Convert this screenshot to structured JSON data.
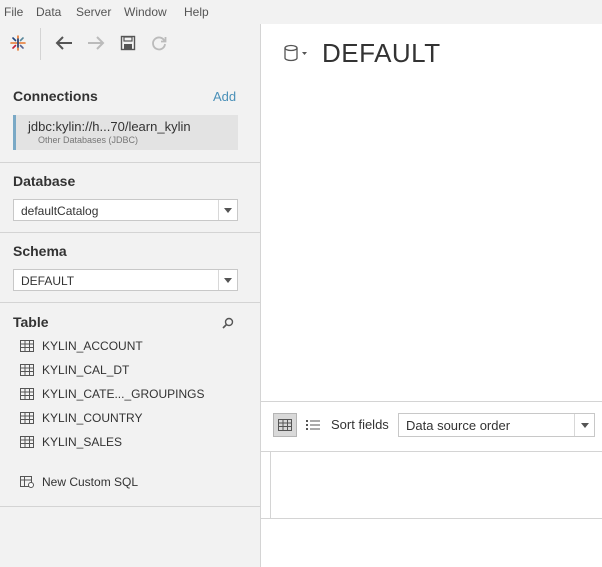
{
  "menu": [
    "File",
    "Data",
    "Server",
    "Window",
    "Help"
  ],
  "connections": {
    "title": "Connections",
    "add_label": "Add",
    "item": {
      "name": "jdbc:kylin://h...70/learn_kylin",
      "type": "Other Databases (JDBC)"
    }
  },
  "database": {
    "title": "Database",
    "value": "defaultCatalog"
  },
  "schema": {
    "title": "Schema",
    "value": "DEFAULT"
  },
  "table": {
    "title": "Table",
    "items": [
      "KYLIN_ACCOUNT",
      "KYLIN_CAL_DT",
      "KYLIN_CATE..._GROUPINGS",
      "KYLIN_COUNTRY",
      "KYLIN_SALES"
    ],
    "custom_sql": "New Custom SQL"
  },
  "main": {
    "title": "DEFAULT"
  },
  "sort": {
    "label": "Sort fields",
    "value": "Data source order"
  },
  "colors": {
    "accent": "#4a90b8",
    "panel": "#f2f2f2",
    "selected_border": "#7aa9c6"
  }
}
